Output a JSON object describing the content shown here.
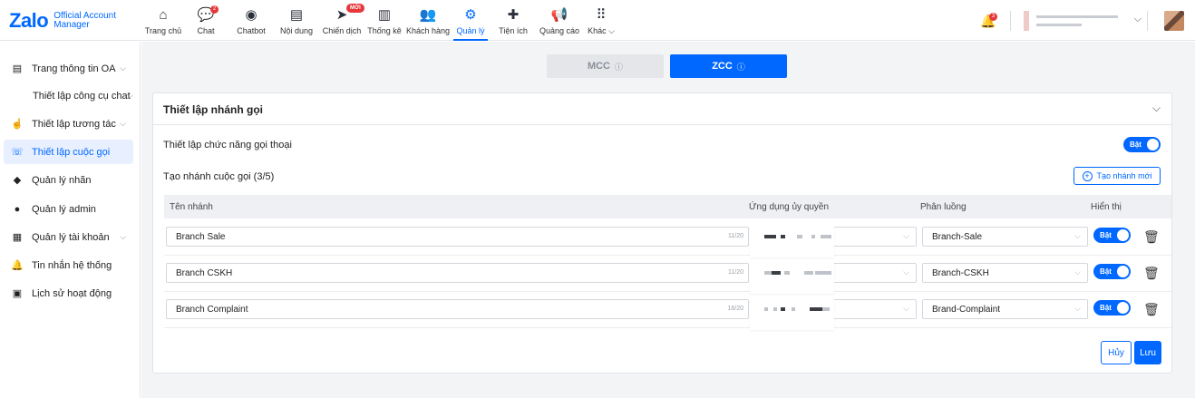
{
  "brand": {
    "logo_text": "Zalo",
    "sub_line1": "Official Account",
    "sub_line2": "Manager",
    "accent": "#0068ff"
  },
  "nav": {
    "items": [
      {
        "label": "Trang chủ",
        "icon": "home-icon"
      },
      {
        "label": "Chat",
        "icon": "chat-icon",
        "badge": "2"
      },
      {
        "label": "Chatbot",
        "icon": "chatbot-icon"
      },
      {
        "label": "Nội dung",
        "icon": "document-icon"
      },
      {
        "label": "Chiến dịch",
        "icon": "paper-plane-icon",
        "badge": "MỚI"
      },
      {
        "label": "Thống kê",
        "icon": "bar-chart-icon"
      },
      {
        "label": "Khách hàng",
        "icon": "users-icon"
      },
      {
        "label": "Quản lý",
        "icon": "gear-icon",
        "active": true
      },
      {
        "label": "Tiện ích",
        "icon": "puzzle-icon"
      },
      {
        "label": "Quảng cáo",
        "icon": "megaphone-icon"
      },
      {
        "label": "Khác",
        "icon": "grid-icon"
      }
    ],
    "notification_badge": "3"
  },
  "sidebar": {
    "items": [
      {
        "label": "Trang thông tin OA",
        "icon": "document-icon"
      },
      {
        "label": "Thiết lập công cụ chat"
      },
      {
        "label": "Thiết lập tương tác",
        "icon": "hand-icon"
      },
      {
        "label": "Thiết lập cuộc gọi",
        "icon": "phone-icon",
        "active": true
      },
      {
        "label": "Quản lý nhãn",
        "icon": "tag-icon"
      },
      {
        "label": "Quản lý admin",
        "icon": "admin-icon"
      },
      {
        "label": "Quản lý tài khoản",
        "icon": "accounts-icon"
      },
      {
        "label": "Tin nhắn hệ thống",
        "icon": "bell-icon"
      },
      {
        "label": "Lịch sử hoạt động",
        "icon": "history-icon"
      }
    ]
  },
  "tabs": {
    "mcc": "MCC",
    "zcc": "ZCC",
    "active": "ZCC"
  },
  "panel": {
    "title": "Thiết lập nhánh gọi",
    "voice_label": "Thiết lập chức năng gọi thoại",
    "voice_toggle": "Bật",
    "branch_count_label": "Tạo nhánh cuộc gọi (3/5)",
    "create_button": "Tạo nhánh mới",
    "columns": {
      "name": "Tên nhánh",
      "app": "Ứng dụng ủy quyền",
      "routing": "Phân luồng",
      "display": "Hiển thị"
    },
    "rows": [
      {
        "name": "Branch Sale",
        "count": "11/20",
        "routing": "Branch-Sale",
        "toggle": "Bật"
      },
      {
        "name": "Branch CSKH",
        "count": "11/20",
        "routing": "Branch-CSKH",
        "toggle": "Bật"
      },
      {
        "name": "Branch Complaint",
        "count": "16/20",
        "routing": "Brand-Complaint",
        "toggle": "Bật"
      }
    ],
    "cancel_button": "Hủy",
    "save_button": "Lưu"
  }
}
